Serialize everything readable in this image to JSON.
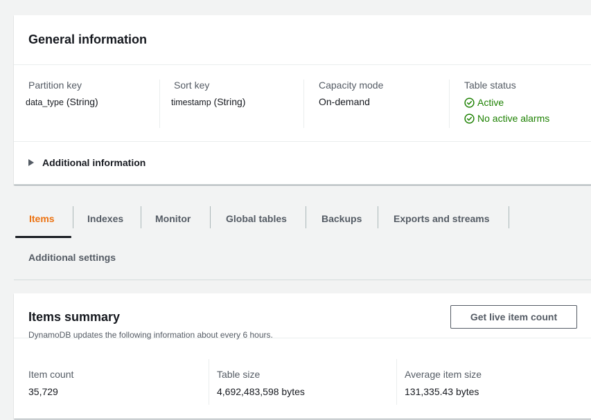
{
  "general_info": {
    "title": "General information",
    "partition_key": {
      "label": "Partition key",
      "name": "data_type",
      "type": "(String)"
    },
    "sort_key": {
      "label": "Sort key",
      "name": "timestamp",
      "type": "(String)"
    },
    "capacity_mode": {
      "label": "Capacity mode",
      "value": "On-demand"
    },
    "table_status": {
      "label": "Table status",
      "status": "Active",
      "alarms": "No active alarms",
      "status_color": "#1d8102",
      "icon": "check-circle-icon"
    },
    "additional_info_label": "Additional information"
  },
  "tabs": {
    "items": [
      {
        "label": "Items",
        "active": true
      },
      {
        "label": "Indexes",
        "active": false
      },
      {
        "label": "Monitor",
        "active": false
      },
      {
        "label": "Global tables",
        "active": false
      },
      {
        "label": "Backups",
        "active": false
      },
      {
        "label": "Exports and streams",
        "active": false
      },
      {
        "label": "Additional settings",
        "active": false
      }
    ],
    "active_color": "#ec7211"
  },
  "items_summary": {
    "title": "Items summary",
    "description": "DynamoDB updates the following information about every 6 hours.",
    "button_label": "Get live item count",
    "item_count": {
      "label": "Item count",
      "value": "35,729"
    },
    "table_size": {
      "label": "Table size",
      "value": "4,692,483,598 bytes"
    },
    "avg_item_size": {
      "label": "Average item size",
      "value": "131,335.43 bytes"
    }
  }
}
